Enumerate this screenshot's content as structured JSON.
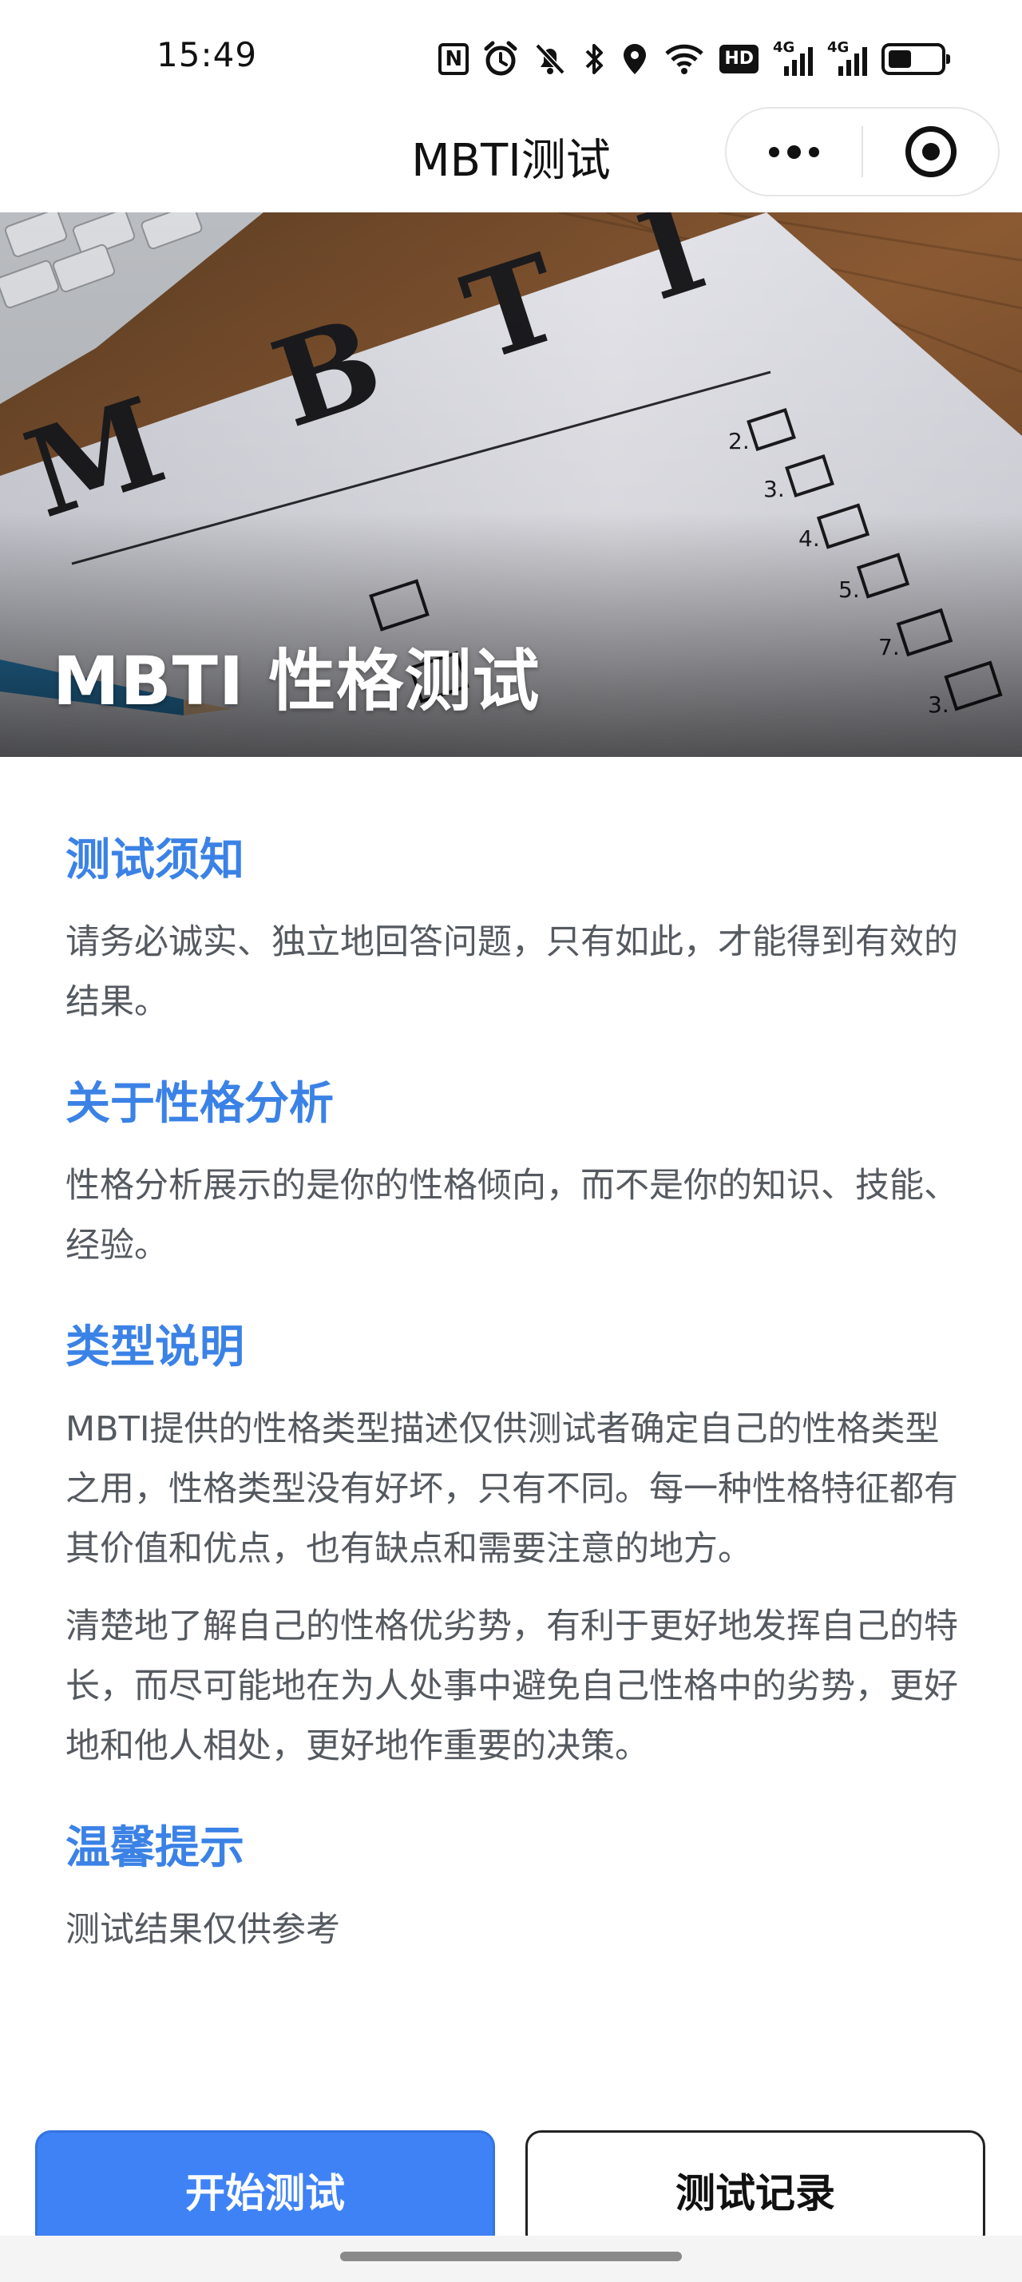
{
  "status_bar": {
    "time": "15:49",
    "icons": [
      "nfc-icon",
      "alarm-icon",
      "mute-icon",
      "bluetooth-icon",
      "location-icon",
      "wifi-icon",
      "hd-icon",
      "4g-signal-icon",
      "4g-signal-icon",
      "battery-icon"
    ],
    "hd_label": "HD",
    "network_label_1": "4G",
    "network_label_2": "4G",
    "nfc_label": "N",
    "battery_level": 0.45
  },
  "nav": {
    "title": "MBTI测试",
    "more_icon": "more-dots-icon",
    "close_icon": "target-close-icon"
  },
  "hero": {
    "title": "MBTI 性格测试",
    "image_letters": "M B T I",
    "checklist_numbers": [
      "2.",
      "3.",
      "4.",
      "5.",
      "7.",
      "3."
    ]
  },
  "sections": [
    {
      "title": "测试须知",
      "paragraphs": [
        "请务必诚实、独立地回答问题，只有如此，才能得到有效的结果。"
      ]
    },
    {
      "title": "关于性格分析",
      "paragraphs": [
        "性格分析展示的是你的性格倾向，而不是你的知识、技能、经验。"
      ]
    },
    {
      "title": "类型说明",
      "paragraphs": [
        "MBTI提供的性格类型描述仅供测试者确定自己的性格类型之用，性格类型没有好坏，只有不同。每一种性格特征都有其价值和优点，也有缺点和需要注意的地方。",
        "清楚地了解自己的性格优劣势，有利于更好地发挥自己的特长，而尽可能地在为人处事中避免自己性格中的劣势，更好地和他人相处，更好地作重要的决策。"
      ]
    },
    {
      "title": "温馨提示",
      "paragraphs": [
        "测试结果仅供参考"
      ]
    }
  ],
  "buttons": {
    "start": "开始测试",
    "history": "测试记录"
  },
  "colors": {
    "accent": "#3b82e6",
    "primary_button": "#3f82f6",
    "body_text": "#555a60"
  }
}
